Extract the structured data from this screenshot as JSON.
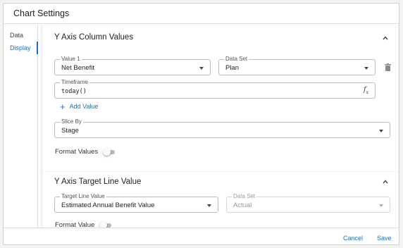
{
  "dialog": {
    "title": "Chart Settings"
  },
  "sidenav": {
    "items": [
      {
        "label": "Data"
      },
      {
        "label": "Display"
      }
    ],
    "active": "Display"
  },
  "y_axis_columns": {
    "title": "Y Axis Column Values",
    "value1": {
      "label": "Value 1",
      "value": "Net Benefit"
    },
    "dataset": {
      "label": "Data Set",
      "value": "Plan"
    },
    "timeframe": {
      "label": "Timeframe",
      "value": "today()"
    },
    "add_value_label": "Add Value",
    "slice_by": {
      "label": "Slice By",
      "value": "Stage"
    },
    "format_values_label": "Format Values",
    "format_values_on": false
  },
  "y_axis_target": {
    "title": "Y Axis Target Line Value",
    "target_value": {
      "label": "Target Line Value",
      "value": "Estimated Annual Benefit Value"
    },
    "dataset": {
      "label": "Data Set",
      "value": "Actual",
      "disabled": true
    },
    "format_value_label": "Format Value",
    "format_value_on": false
  },
  "footer": {
    "cancel_label": "Cancel",
    "save_label": "Save"
  },
  "colors": {
    "accent": "#1a73c8",
    "border": "#bdbdbd",
    "background": "#f4f4f4"
  },
  "icons": {
    "collapse": "chevron-up-icon",
    "dropdown": "caret-down-icon",
    "delete": "trash-icon",
    "formula": "function-icon",
    "add": "plus-icon"
  }
}
